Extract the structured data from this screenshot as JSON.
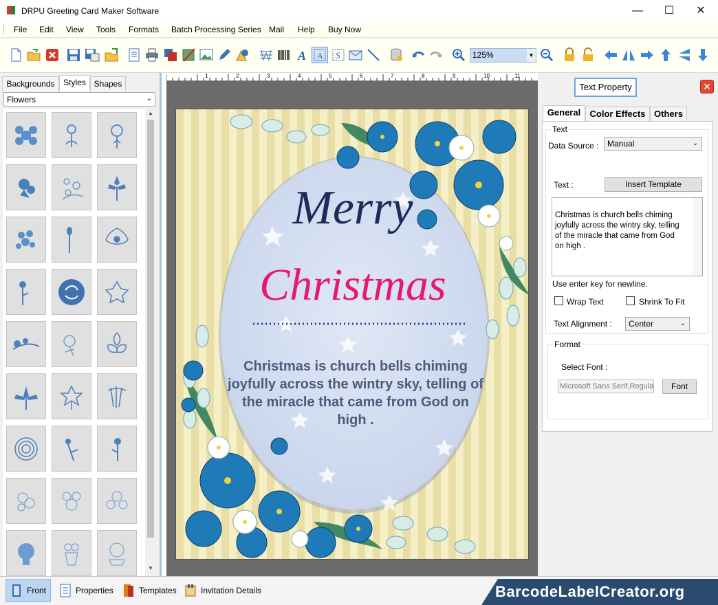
{
  "window": {
    "title": "DRPU Greeting Card Maker Software"
  },
  "menu": [
    "File",
    "Edit",
    "View",
    "Tools",
    "Formats",
    "Batch Processing Series",
    "Mail",
    "Help",
    "Buy Now"
  ],
  "toolbar": {
    "zoom": "125%"
  },
  "left_panel": {
    "tabs": [
      "Backgrounds",
      "Styles",
      "Shapes"
    ],
    "selected_tab": "Styles",
    "category": "Flowers"
  },
  "canvas": {
    "card_title_line1": "Merry",
    "card_title_line2": "Christmas",
    "card_body": "Christmas is church bells chiming joyfully across the wintry sky, telling of the miracle that came from God on high .",
    "ruler_numbers": [
      "1",
      "2",
      "3",
      "4",
      "5",
      "6",
      "7",
      "8",
      "9",
      "10",
      "11"
    ]
  },
  "right_panel": {
    "title": "Text Property",
    "tabs": [
      "General",
      "Color Effects",
      "Others"
    ],
    "text_group": "Text",
    "data_source_label": "Data Source :",
    "data_source_value": "Manual",
    "text_label": "Text :",
    "insert_template": "Insert Template",
    "text_value": "Christmas is church bells chiming\njoyfully across the wintry sky, telling\nof the miracle that came from God\non high .",
    "hint": "Use enter key for newline.",
    "wrap_text": "Wrap Text",
    "shrink_to_fit": "Shrink To Fit",
    "alignment_label": "Text Alignment :",
    "alignment_value": "Center",
    "format_group": "Format",
    "select_font_label": "Select Font :",
    "font_value": "Microsoft Sans Serif,Regular",
    "font_button": "Font"
  },
  "bottom_tabs": [
    "Front",
    "Properties",
    "Templates",
    "Invitation Details"
  ],
  "brand": "BarcodeLabelCreator.org",
  "colors": {
    "accent": "#6fa3e0",
    "card_title_dark": "#1c2b5a",
    "card_title_pink": "#e8186e",
    "brand_bg": "#2a4a6e"
  }
}
